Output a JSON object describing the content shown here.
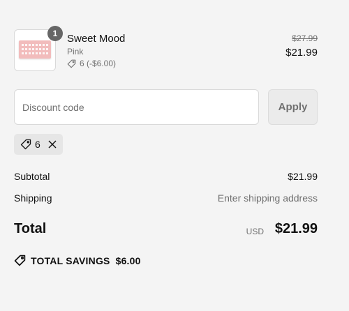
{
  "cart_item": {
    "name": "Sweet Mood",
    "variant": "Pink",
    "quantity": "1",
    "discount_label": "6 (-$6.00)",
    "original_price": "$27.99",
    "price": "$21.99",
    "image_icon": "press-on-nails-product-image"
  },
  "discount": {
    "placeholder": "Discount code",
    "value": "",
    "apply_label": "Apply",
    "applied_code": "6"
  },
  "summary": {
    "subtotal_label": "Subtotal",
    "subtotal_value": "$21.99",
    "shipping_label": "Shipping",
    "shipping_value": "Enter shipping address",
    "total_label": "Total",
    "currency": "USD",
    "total_value": "$21.99",
    "savings_label": "TOTAL SAVINGS",
    "savings_value": "$6.00"
  },
  "colors": {
    "background": "#f4f4f4",
    "muted_text": "#707070",
    "badge": "#666666"
  }
}
